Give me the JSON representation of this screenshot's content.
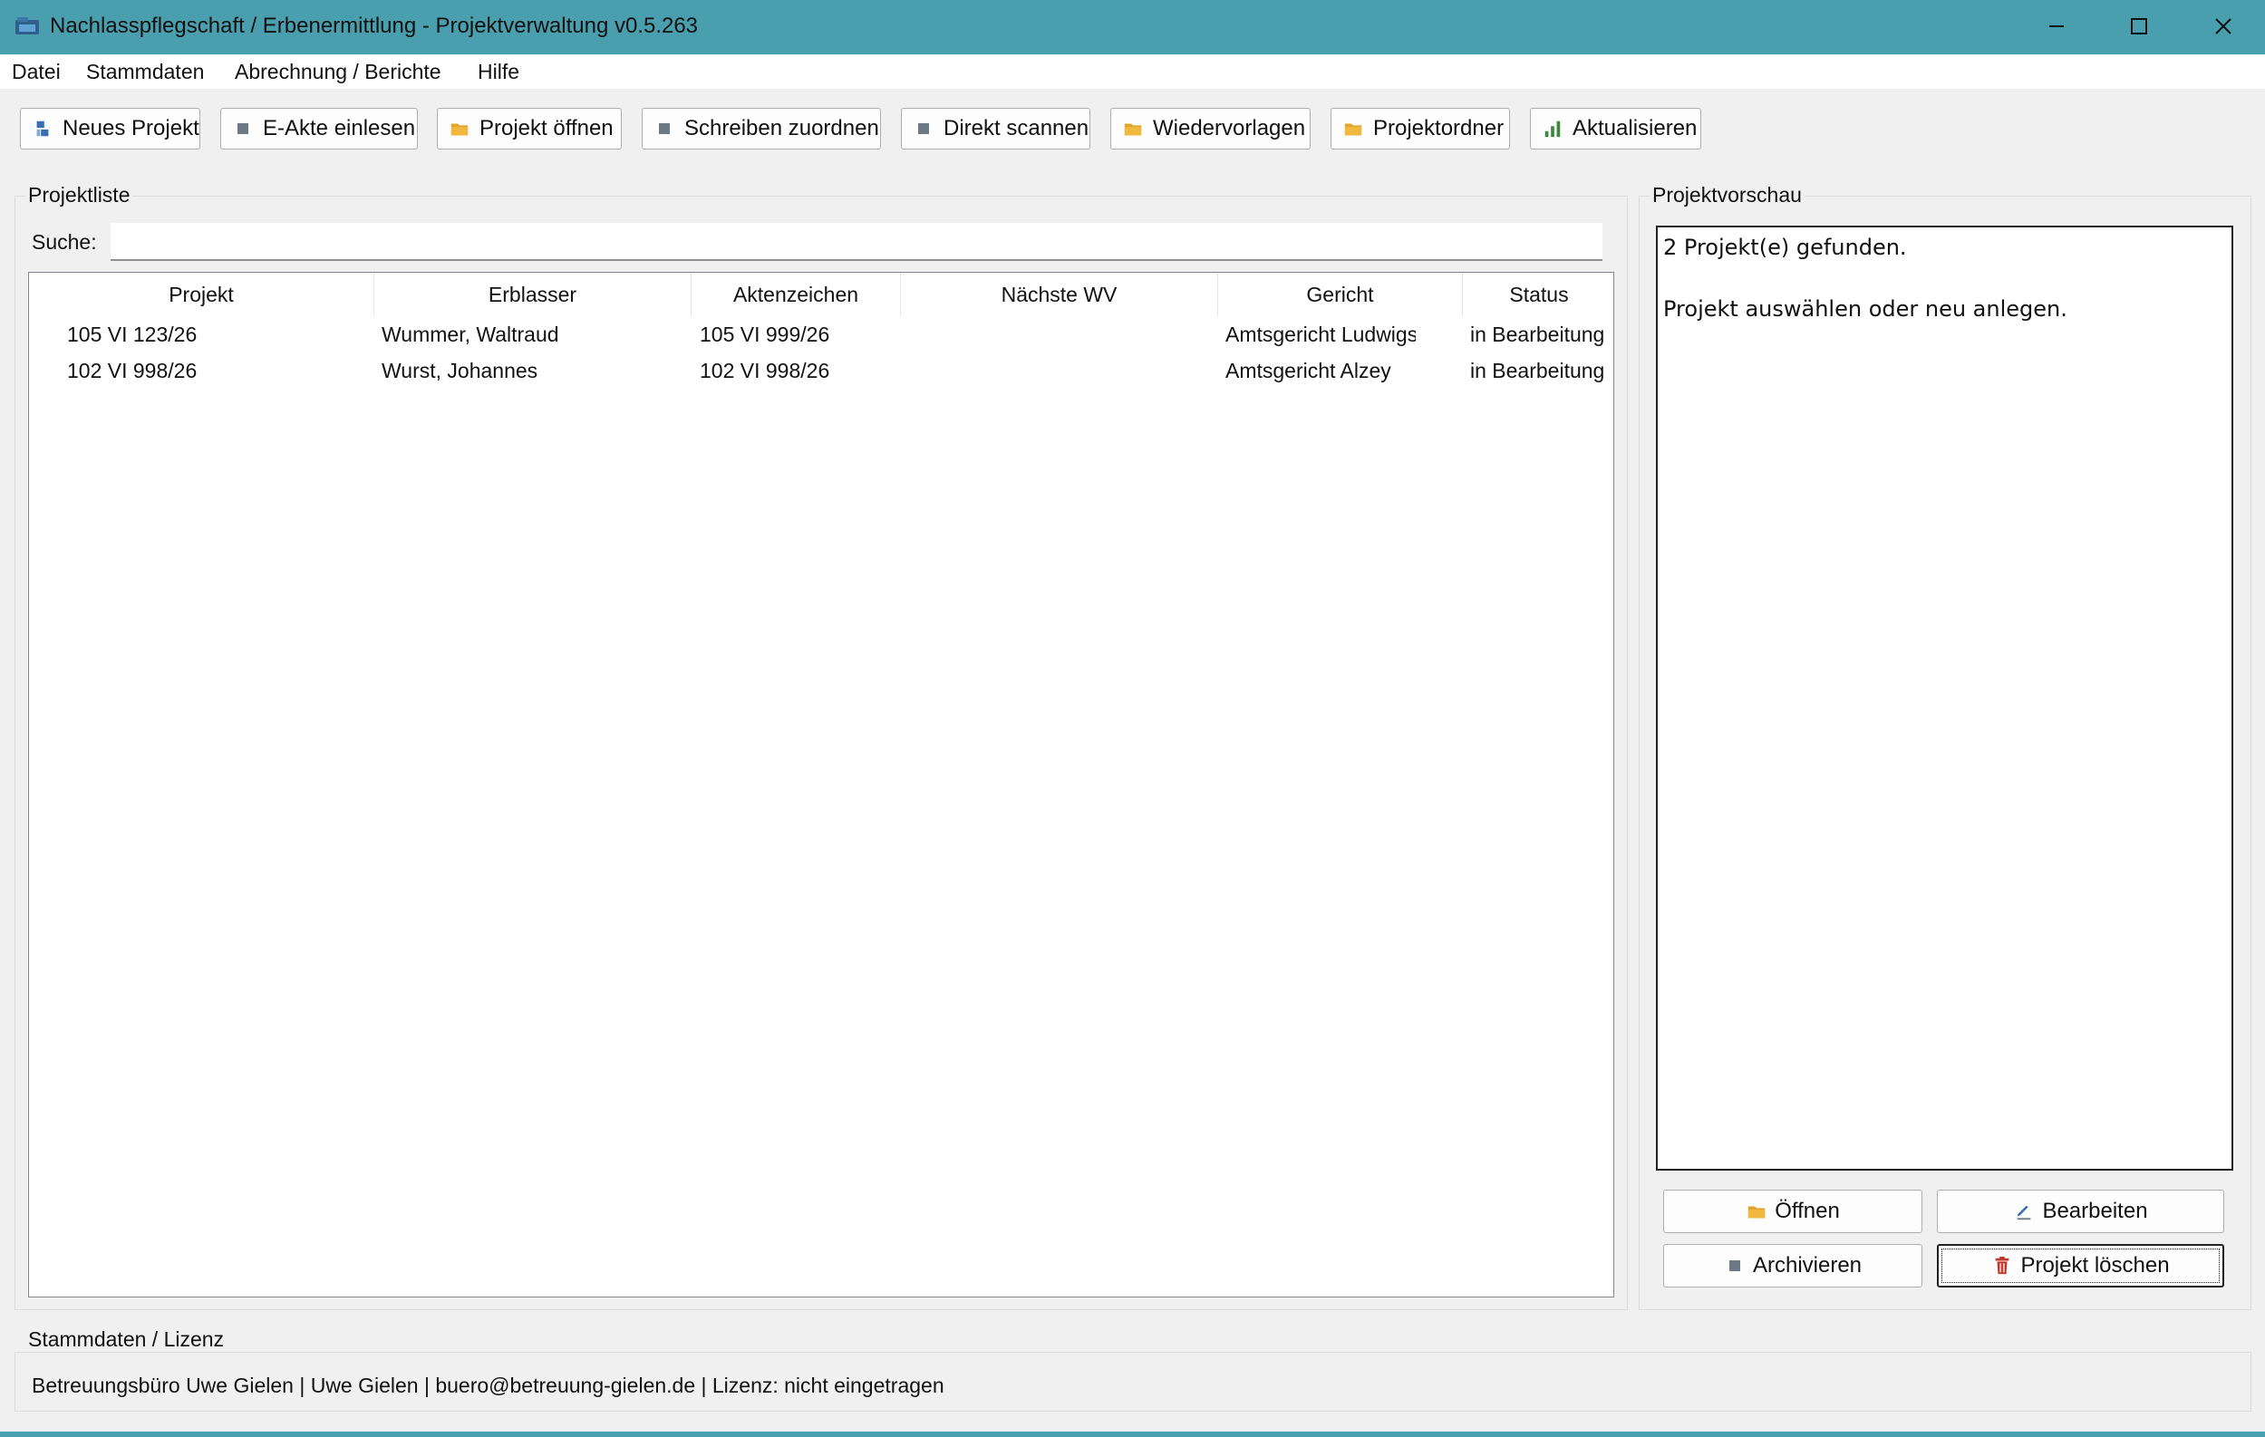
{
  "window": {
    "title": "Nachlasspflegschaft / Erbenermittlung - Projektverwaltung v0.5.263",
    "accent_color": "#4a9fae"
  },
  "menu": [
    "Datei",
    "Stammdaten",
    "Abrechnung / Berichte",
    "Hilfe"
  ],
  "toolbar": [
    {
      "label": "Neues Projekt",
      "icon": "new-project-icon"
    },
    {
      "label": "E-Akte einlesen",
      "icon": "square-icon"
    },
    {
      "label": "Projekt öffnen",
      "icon": "folder-icon"
    },
    {
      "label": "Schreiben zuordnen",
      "icon": "square-icon"
    },
    {
      "label": "Direkt scannen",
      "icon": "square-icon"
    },
    {
      "label": "Wiedervorlagen",
      "icon": "folder-icon"
    },
    {
      "label": "Projektordner",
      "icon": "folder-icon"
    },
    {
      "label": "Aktualisieren",
      "icon": "bar-chart-icon"
    }
  ],
  "project_list": {
    "group_label": "Projektliste",
    "search_label": "Suche:",
    "search_value": "",
    "columns": [
      "Projekt",
      "Erblasser",
      "Aktenzeichen",
      "Nächste WV",
      "Gericht",
      "Status"
    ],
    "rows": [
      [
        "105 VI 123/26",
        "Wummer, Waltraud",
        "105 VI 999/26",
        "",
        "Amtsgericht Ludwigshafen",
        "in Bearbeitung"
      ],
      [
        "102 VI 998/26",
        "Wurst, Johannes",
        "102 VI 998/26",
        "",
        "Amtsgericht Alzey",
        "in Bearbeitung"
      ]
    ]
  },
  "preview": {
    "group_label": "Projektvorschau",
    "lines": [
      "2 Projekt(e) gefunden.",
      "",
      "Projekt auswählen oder neu anlegen."
    ],
    "buttons": {
      "open": "Öffnen",
      "edit": "Bearbeiten",
      "archive": "Archivieren",
      "delete": "Projekt löschen"
    }
  },
  "license": {
    "group_label": "Stammdaten / Lizenz",
    "text": "Betreuungsbüro Uwe Gielen | Uwe Gielen | buero@betreuung-gielen.de | Lizenz: nicht eingetragen"
  }
}
